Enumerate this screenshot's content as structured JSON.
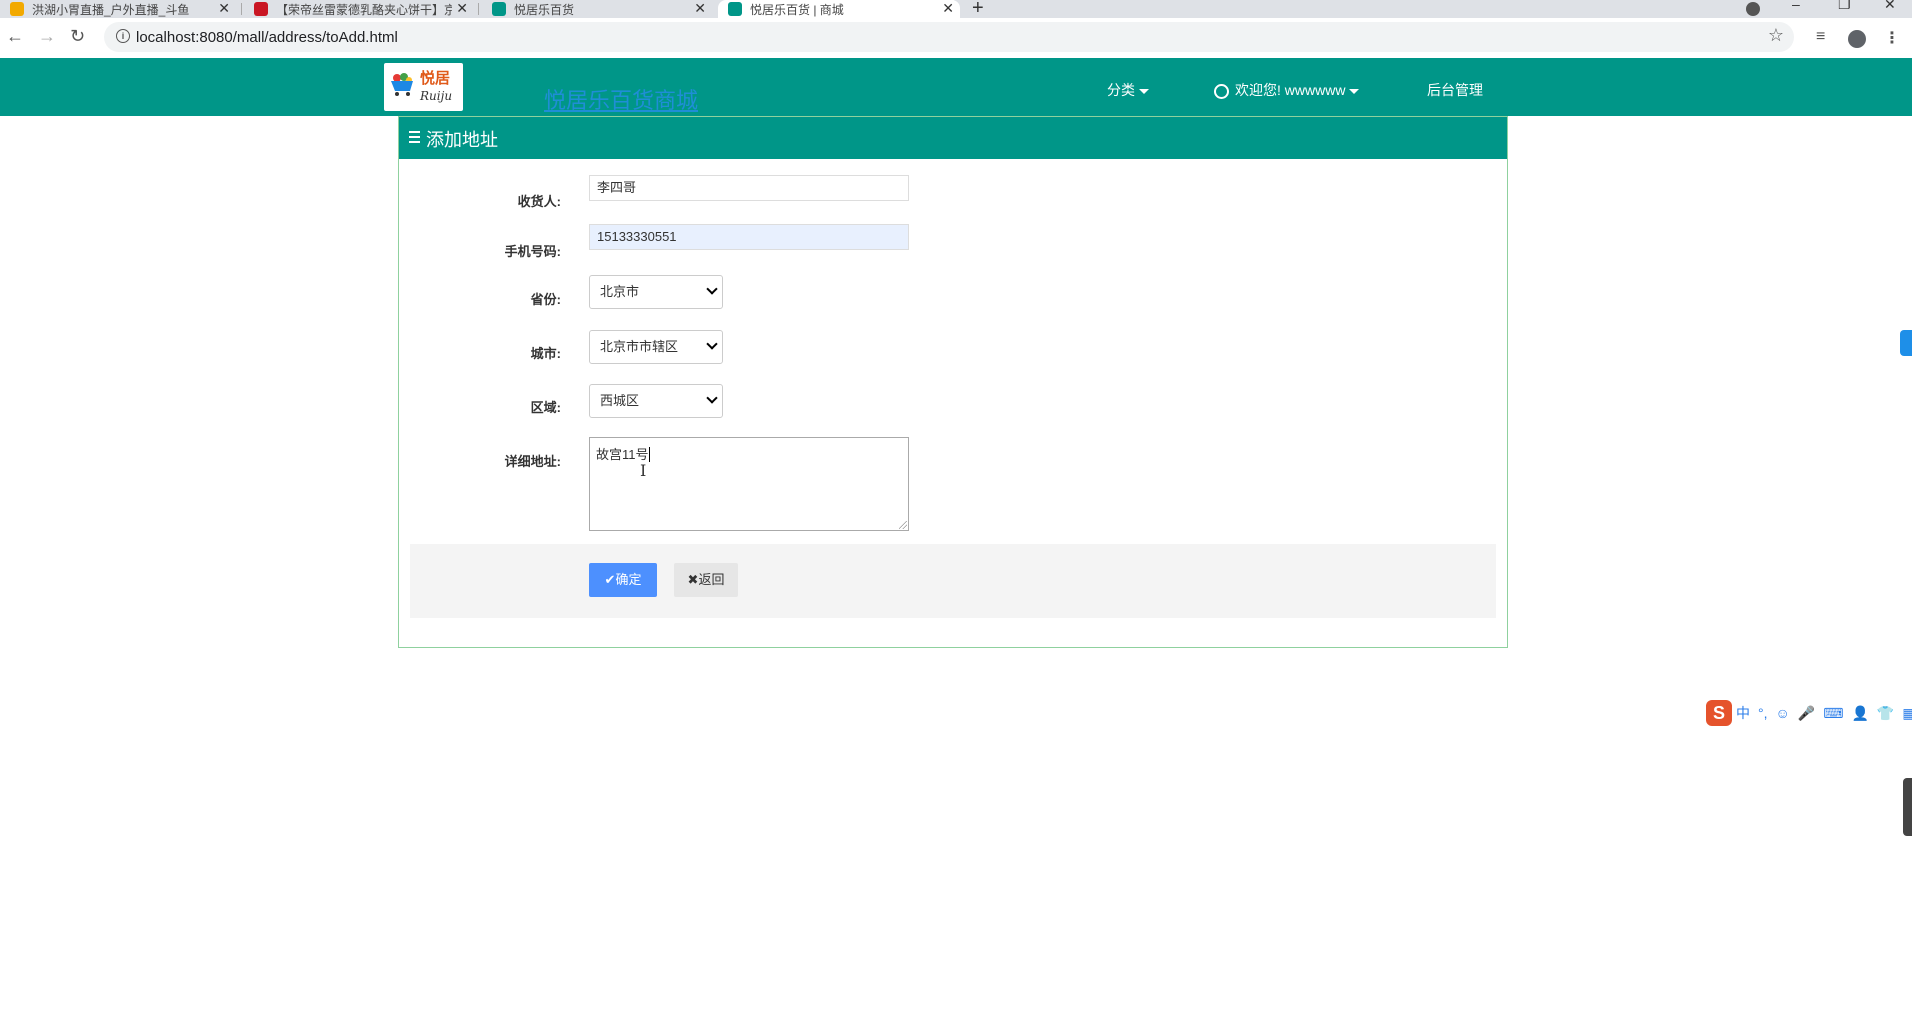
{
  "browser": {
    "tabs": [
      {
        "title": "洪湖小胃直播_户外直播_斗鱼",
        "active": false
      },
      {
        "title": "【荣帝丝雷蒙德乳酪夹心饼干】京",
        "active": false
      },
      {
        "title": "悦居乐百货",
        "active": false
      },
      {
        "title": "悦居乐百货 | 商城",
        "active": true
      }
    ],
    "new_tab": "+",
    "close_glyph": "✕",
    "url": "localhost:8080/mall/address/toAdd.html",
    "window_controls": [
      "–",
      "❐",
      "✕"
    ]
  },
  "header": {
    "logo_text": "悦居",
    "logo_script": "Ruiju",
    "site_title": "悦居乐百货商城",
    "nav": {
      "category_label": "分类",
      "user_label": "欢迎您! wwwwww",
      "admin_label": "后台管理"
    }
  },
  "panel": {
    "title": "添加地址"
  },
  "form": {
    "receiver_label": "收货人:",
    "receiver_value": "李四哥",
    "phone_label": "手机号码:",
    "phone_value": "15133330551",
    "province_label": "省份:",
    "province_value": "北京市",
    "city_label": "城市:",
    "city_value": "北京市市辖区",
    "district_label": "区域:",
    "district_value": "西城区",
    "address_label": "详细地址:",
    "address_value": "故宫11号",
    "confirm_label": "确定",
    "back_label": "返回"
  },
  "ime": {
    "items": [
      "中",
      "°,",
      "☺",
      "🎤",
      "⌨",
      "👤",
      "👕",
      "▦"
    ]
  }
}
